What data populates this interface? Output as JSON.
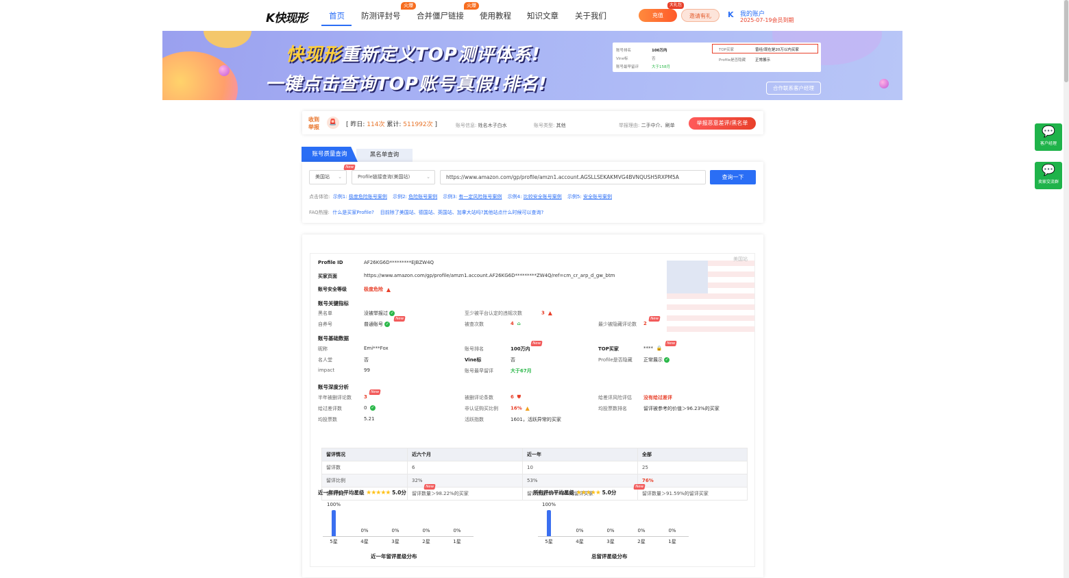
{
  "nav": {
    "logo": "K快现形",
    "items": [
      {
        "label": "首页",
        "active": true
      },
      {
        "label": "防测评封号",
        "badge": "火爆"
      },
      {
        "label": "合并僵尸链接",
        "badge": "火爆"
      },
      {
        "label": "使用教程"
      },
      {
        "label": "知识文章"
      },
      {
        "label": "关于我们"
      }
    ],
    "recharge": "充值",
    "invite": "邀请有礼",
    "gift_badge": "大礼包",
    "account_icon": "K",
    "account_name": "我的账户",
    "account_expiry": "2025-07-19会员到期"
  },
  "banner": {
    "line1_brand": "快现形",
    "line1_rest": "重新定义TOP测评体系!",
    "line2": "一键点击查询TOP账号真假!排名!",
    "card": {
      "rank_label": "账号排名",
      "rank_value": "100万内",
      "vine_label": "Vine标",
      "vine_value": "否",
      "review_label": "账号最早留评",
      "review_value": "大于158月",
      "top_label": "TOP买家",
      "top_value": "曾经/现在是20万以内买家",
      "profile_label": "Profile是否隐藏",
      "profile_value": "正常展示"
    },
    "cta": "合作联系客户经理"
  },
  "ticker": {
    "label": "收到举报",
    "icon": "🚨",
    "yesterday_label": "昨日:",
    "yesterday_value": "114次",
    "total_label": "累计:",
    "total_value": "511992次",
    "a1": "账号信息:",
    "a1v": "姓名木子白水",
    "b1": "账号类型:",
    "b1v": "其他",
    "c1": "举报理由:",
    "c1v": "二手中介、刷单",
    "report_button": "举报恶意差评/黑名单"
  },
  "tabs": {
    "quality": "账号质量查询",
    "blacklist": "黑名单查询"
  },
  "query": {
    "site": "美国站",
    "type": "Profile链接查询(美国站)",
    "url": "https://www.amazon.com/gp/profile/amzn1.account.AGSLLSEKAKMVG4BVNQUSH5RXPM5A",
    "button": "查询一下",
    "new": "New",
    "examples_label": "点击体验:",
    "examples": [
      {
        "prefix": "示例1:",
        "link": "极度危险账号案例"
      },
      {
        "prefix": "示例2:",
        "link": "危险账号案例"
      },
      {
        "prefix": "示例3:",
        "link": "有一定风险账号案例"
      },
      {
        "prefix": "示例4:",
        "link": "比较安全账号案例"
      },
      {
        "prefix": "示例5:",
        "link": "安全账号案例"
      }
    ],
    "faq_label": "FAQ热搜:",
    "faq": [
      "什么是买家Profile?",
      "目前除了美国站、德国站、英国站、加拿大站吗?其他站点什么时候可以查询?"
    ]
  },
  "result": {
    "region": "美国站",
    "profile_id_label": "Profile ID",
    "profile_id": "AF26KG6D*********EJBZW4Q",
    "buyer_page_label": "买家页面",
    "buyer_page": "https://www.amazon.com/gp/profile/amzn1.account.AF26KG6D*********ZW4Q/ref=cm_cr_arp_d_gw_btm",
    "safety_label": "账号安全等级",
    "safety_value": "极度危险",
    "key_title": "账号关键指标",
    "blacklist_label": "黑名单",
    "blacklist_value": "没被举报过",
    "violations_label": "至少被平台认定的违规次数",
    "violations_value": "3",
    "selfbuy_label": "自养号",
    "selfbuy_value": "普通账号",
    "checked_label": "被查次数",
    "checked_value": "4",
    "hidden_label": "最少被隐藏评论数",
    "hidden_value": "2",
    "basic_title": "账号基础数据",
    "nick_label": "昵称",
    "nick_value": "Emi***Fox",
    "rank_label": "账号排名",
    "rank_value": "100万内",
    "top_label": "TOP买家",
    "top_value": "****",
    "fame_label": "名人堂",
    "fame_value": "否",
    "vine_label": "Vine标",
    "vine_value": "否",
    "profile_label": "Profile是否隐藏",
    "profile_value": "正常展示",
    "impact_label": "impact",
    "impact_value": "99",
    "earliest_label": "账号最早留评",
    "earliest_value": "大于67月",
    "deep_title": "账号深度分析",
    "half_deleted_label": "半年被删评论数",
    "half_deleted_value": "3",
    "deleted_label": "被删评论条数",
    "deleted_value": "6",
    "neg_risk_label": "给差评风险评估",
    "neg_risk_value": "没有给过差评",
    "neg_given_label": "给过差评数",
    "neg_given_value": "0",
    "unverified_label": "非认证购买比例",
    "unverified_value": "16%",
    "avg_votes_rank_label": "均投票数排名",
    "avg_votes_rank_value": "留评被参考的价值＞96.23%的买家",
    "avg_votes_label": "均投票数",
    "avg_votes_value": "5.21",
    "activity_label": "活跃指数",
    "activity_value": "1601，活跃异常的买家",
    "table": {
      "headers": [
        "留评情况",
        "近六个月",
        "近一年",
        "全部"
      ],
      "rows": [
        [
          "留评数",
          "6",
          "10",
          "25"
        ],
        [
          "留评比例",
          "32%",
          "53%",
          "76%"
        ],
        [
          "留评排名",
          "留评数量＞98.22%的买家",
          "留评数量＞97.86%的留评买家",
          "留评数量＞91.59%的留评买家"
        ]
      ]
    },
    "year_rating_label": "近一年评价平均星级",
    "year_rating_value": "5.0分",
    "all_rating_label": "所有评价平均星级",
    "all_rating_value": "5.0分",
    "year_caption": "近一年留评星级分布",
    "all_caption": "总留评星级分布"
  },
  "chart_data": [
    {
      "type": "bar",
      "categories": [
        "5星",
        "4星",
        "3星",
        "2星",
        "1星"
      ],
      "values": [
        100,
        0,
        0,
        0,
        0
      ],
      "labels": [
        "100%",
        "0%",
        "0%",
        "0%",
        "0%"
      ],
      "title": "近一年留评星级分布"
    },
    {
      "type": "bar",
      "categories": [
        "5星",
        "4星",
        "3星",
        "2星",
        "1星"
      ],
      "values": [
        100,
        0,
        0,
        0,
        0
      ],
      "labels": [
        "100%",
        "0%",
        "0%",
        "0%",
        "0%"
      ],
      "title": "总留评星级分布"
    }
  ],
  "side": {
    "manager": "客户经理",
    "group": "卖家交流群"
  },
  "colors": {
    "primary": "#2a6ef5",
    "danger": "#e8402a",
    "success": "#2bb84a",
    "orange": "#e8742a"
  }
}
